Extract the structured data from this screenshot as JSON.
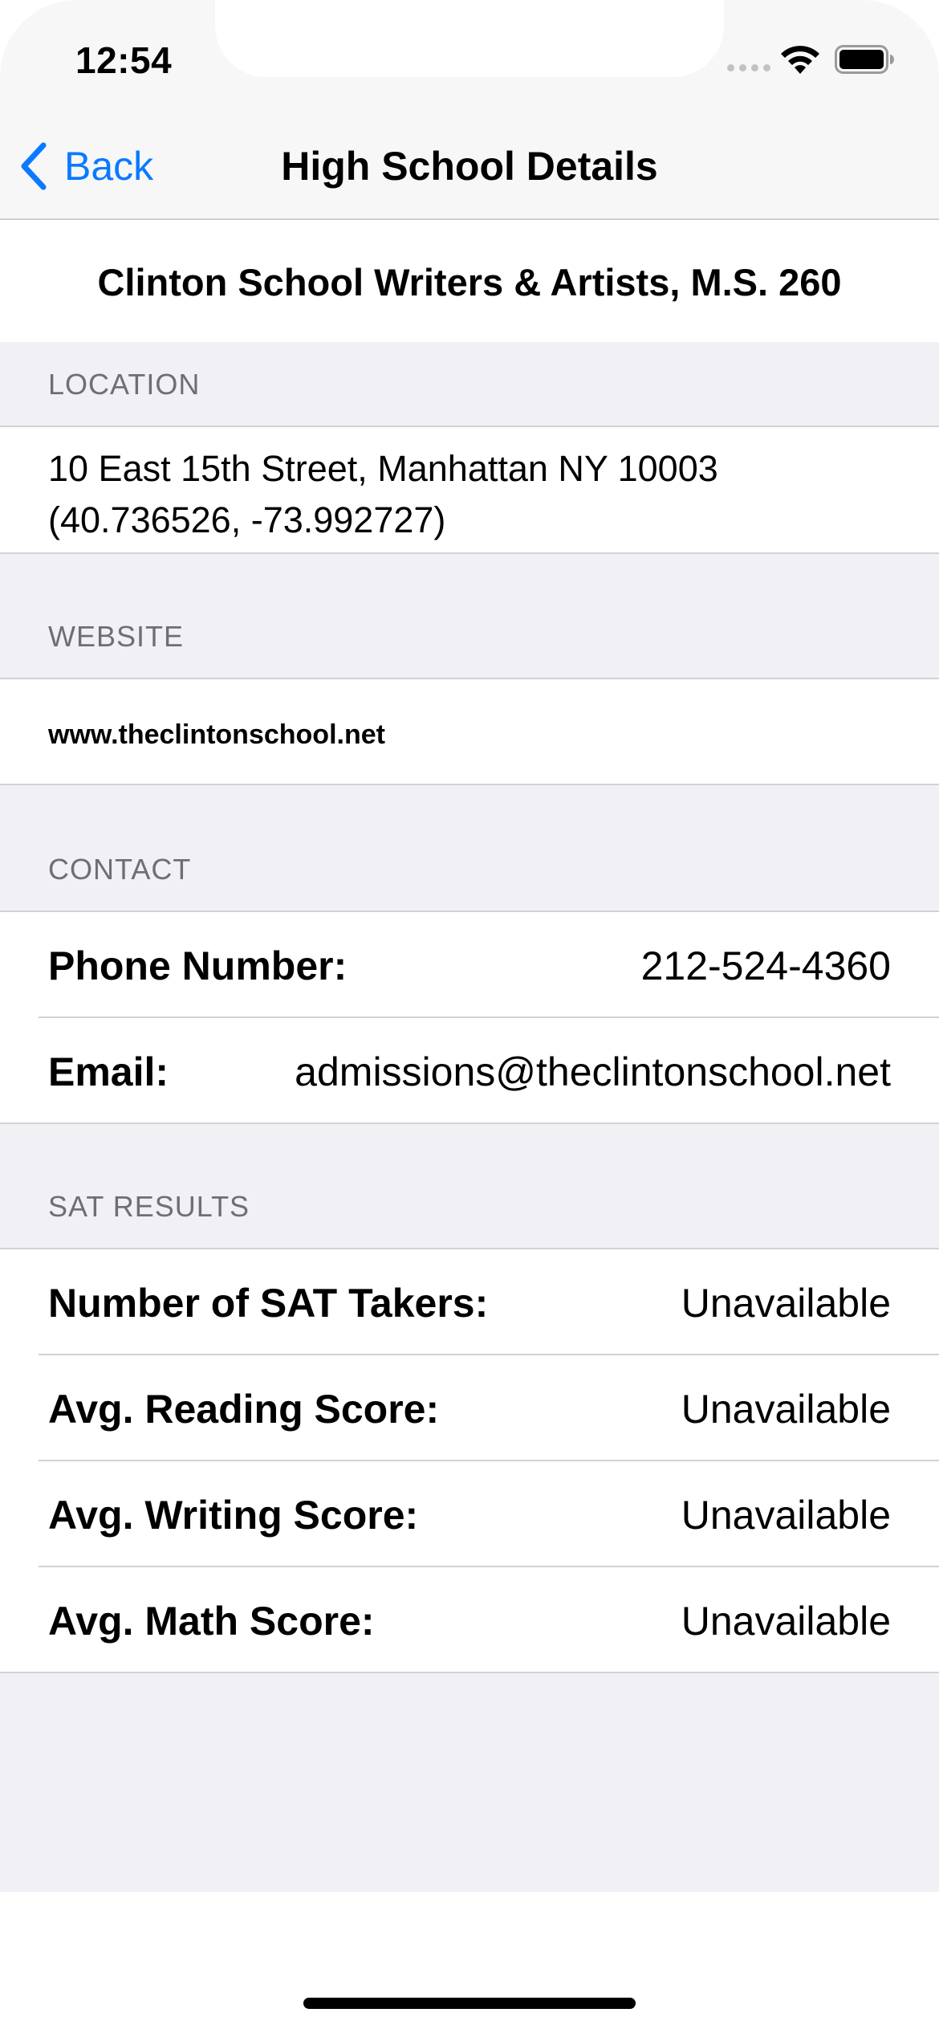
{
  "status_bar": {
    "time": "12:54"
  },
  "nav": {
    "back_label": "Back",
    "title": "High School Details"
  },
  "school": {
    "name": "Clinton School Writers & Artists, M.S. 260"
  },
  "location": {
    "header": "LOCATION",
    "address_line": "10 East 15th Street, Manhattan NY 10003",
    "coordinates": "(40.736526, -73.992727)"
  },
  "website": {
    "header": "WEBSITE",
    "url": "www.theclintonschool.net"
  },
  "contact": {
    "header": "CONTACT",
    "rows": [
      {
        "label": "Phone Number:",
        "value": "212-524-4360"
      },
      {
        "label": "Email:",
        "value": "admissions@theclintonschool.net"
      }
    ]
  },
  "sat": {
    "header": "SAT RESULTS",
    "rows": [
      {
        "label": "Number of SAT Takers:",
        "value": "Unavailable"
      },
      {
        "label": "Avg. Reading Score:",
        "value": "Unavailable"
      },
      {
        "label": "Avg. Writing Score:",
        "value": "Unavailable"
      },
      {
        "label": "Avg. Math Score:",
        "value": "Unavailable"
      }
    ]
  },
  "colors": {
    "accent": "#0a7aff",
    "grouped_background": "#f0f0f5",
    "secondary_text": "#6e6e73"
  },
  "icons": {
    "back": "chevron-left-icon",
    "wifi": "wifi-icon",
    "battery": "battery-icon",
    "signal": "cellular-signal-icon"
  }
}
